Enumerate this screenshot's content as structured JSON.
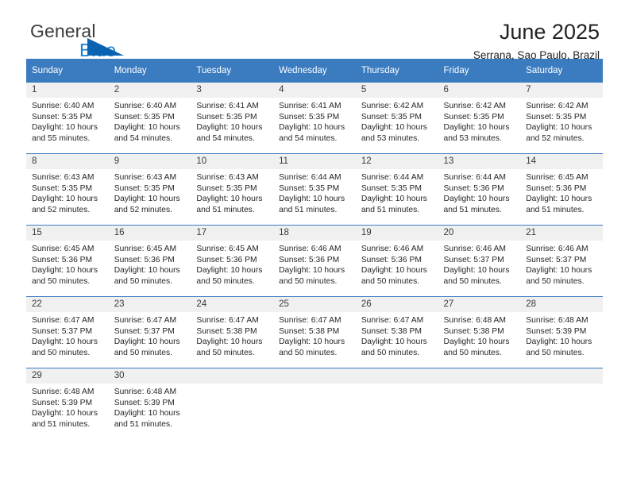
{
  "brand": {
    "name_top": "General",
    "name_bottom": "Blue",
    "triangle_icon": "triangle-icon",
    "accent_color": "#0a63b0",
    "blue_text_color": "#1a7fd4"
  },
  "header": {
    "title": "June 2025",
    "subtitle": "Serrana, Sao Paulo, Brazil"
  },
  "calendar": {
    "header_bg": "#3b7cc0",
    "daynum_bg": "#f0f0f0",
    "weekdays": [
      "Sunday",
      "Monday",
      "Tuesday",
      "Wednesday",
      "Thursday",
      "Friday",
      "Saturday"
    ],
    "weeks": [
      [
        {
          "day": "1",
          "lines": [
            "Sunrise: 6:40 AM",
            "Sunset: 5:35 PM",
            "Daylight: 10 hours",
            "and 55 minutes."
          ]
        },
        {
          "day": "2",
          "lines": [
            "Sunrise: 6:40 AM",
            "Sunset: 5:35 PM",
            "Daylight: 10 hours",
            "and 54 minutes."
          ]
        },
        {
          "day": "3",
          "lines": [
            "Sunrise: 6:41 AM",
            "Sunset: 5:35 PM",
            "Daylight: 10 hours",
            "and 54 minutes."
          ]
        },
        {
          "day": "4",
          "lines": [
            "Sunrise: 6:41 AM",
            "Sunset: 5:35 PM",
            "Daylight: 10 hours",
            "and 54 minutes."
          ]
        },
        {
          "day": "5",
          "lines": [
            "Sunrise: 6:42 AM",
            "Sunset: 5:35 PM",
            "Daylight: 10 hours",
            "and 53 minutes."
          ]
        },
        {
          "day": "6",
          "lines": [
            "Sunrise: 6:42 AM",
            "Sunset: 5:35 PM",
            "Daylight: 10 hours",
            "and 53 minutes."
          ]
        },
        {
          "day": "7",
          "lines": [
            "Sunrise: 6:42 AM",
            "Sunset: 5:35 PM",
            "Daylight: 10 hours",
            "and 52 minutes."
          ]
        }
      ],
      [
        {
          "day": "8",
          "lines": [
            "Sunrise: 6:43 AM",
            "Sunset: 5:35 PM",
            "Daylight: 10 hours",
            "and 52 minutes."
          ]
        },
        {
          "day": "9",
          "lines": [
            "Sunrise: 6:43 AM",
            "Sunset: 5:35 PM",
            "Daylight: 10 hours",
            "and 52 minutes."
          ]
        },
        {
          "day": "10",
          "lines": [
            "Sunrise: 6:43 AM",
            "Sunset: 5:35 PM",
            "Daylight: 10 hours",
            "and 51 minutes."
          ]
        },
        {
          "day": "11",
          "lines": [
            "Sunrise: 6:44 AM",
            "Sunset: 5:35 PM",
            "Daylight: 10 hours",
            "and 51 minutes."
          ]
        },
        {
          "day": "12",
          "lines": [
            "Sunrise: 6:44 AM",
            "Sunset: 5:35 PM",
            "Daylight: 10 hours",
            "and 51 minutes."
          ]
        },
        {
          "day": "13",
          "lines": [
            "Sunrise: 6:44 AM",
            "Sunset: 5:36 PM",
            "Daylight: 10 hours",
            "and 51 minutes."
          ]
        },
        {
          "day": "14",
          "lines": [
            "Sunrise: 6:45 AM",
            "Sunset: 5:36 PM",
            "Daylight: 10 hours",
            "and 51 minutes."
          ]
        }
      ],
      [
        {
          "day": "15",
          "lines": [
            "Sunrise: 6:45 AM",
            "Sunset: 5:36 PM",
            "Daylight: 10 hours",
            "and 50 minutes."
          ]
        },
        {
          "day": "16",
          "lines": [
            "Sunrise: 6:45 AM",
            "Sunset: 5:36 PM",
            "Daylight: 10 hours",
            "and 50 minutes."
          ]
        },
        {
          "day": "17",
          "lines": [
            "Sunrise: 6:45 AM",
            "Sunset: 5:36 PM",
            "Daylight: 10 hours",
            "and 50 minutes."
          ]
        },
        {
          "day": "18",
          "lines": [
            "Sunrise: 6:46 AM",
            "Sunset: 5:36 PM",
            "Daylight: 10 hours",
            "and 50 minutes."
          ]
        },
        {
          "day": "19",
          "lines": [
            "Sunrise: 6:46 AM",
            "Sunset: 5:36 PM",
            "Daylight: 10 hours",
            "and 50 minutes."
          ]
        },
        {
          "day": "20",
          "lines": [
            "Sunrise: 6:46 AM",
            "Sunset: 5:37 PM",
            "Daylight: 10 hours",
            "and 50 minutes."
          ]
        },
        {
          "day": "21",
          "lines": [
            "Sunrise: 6:46 AM",
            "Sunset: 5:37 PM",
            "Daylight: 10 hours",
            "and 50 minutes."
          ]
        }
      ],
      [
        {
          "day": "22",
          "lines": [
            "Sunrise: 6:47 AM",
            "Sunset: 5:37 PM",
            "Daylight: 10 hours",
            "and 50 minutes."
          ]
        },
        {
          "day": "23",
          "lines": [
            "Sunrise: 6:47 AM",
            "Sunset: 5:37 PM",
            "Daylight: 10 hours",
            "and 50 minutes."
          ]
        },
        {
          "day": "24",
          "lines": [
            "Sunrise: 6:47 AM",
            "Sunset: 5:38 PM",
            "Daylight: 10 hours",
            "and 50 minutes."
          ]
        },
        {
          "day": "25",
          "lines": [
            "Sunrise: 6:47 AM",
            "Sunset: 5:38 PM",
            "Daylight: 10 hours",
            "and 50 minutes."
          ]
        },
        {
          "day": "26",
          "lines": [
            "Sunrise: 6:47 AM",
            "Sunset: 5:38 PM",
            "Daylight: 10 hours",
            "and 50 minutes."
          ]
        },
        {
          "day": "27",
          "lines": [
            "Sunrise: 6:48 AM",
            "Sunset: 5:38 PM",
            "Daylight: 10 hours",
            "and 50 minutes."
          ]
        },
        {
          "day": "28",
          "lines": [
            "Sunrise: 6:48 AM",
            "Sunset: 5:39 PM",
            "Daylight: 10 hours",
            "and 50 minutes."
          ]
        }
      ],
      [
        {
          "day": "29",
          "lines": [
            "Sunrise: 6:48 AM",
            "Sunset: 5:39 PM",
            "Daylight: 10 hours",
            "and 51 minutes."
          ]
        },
        {
          "day": "30",
          "lines": [
            "Sunrise: 6:48 AM",
            "Sunset: 5:39 PM",
            "Daylight: 10 hours",
            "and 51 minutes."
          ]
        },
        {
          "day": "",
          "lines": []
        },
        {
          "day": "",
          "lines": []
        },
        {
          "day": "",
          "lines": []
        },
        {
          "day": "",
          "lines": []
        },
        {
          "day": "",
          "lines": []
        }
      ]
    ]
  }
}
